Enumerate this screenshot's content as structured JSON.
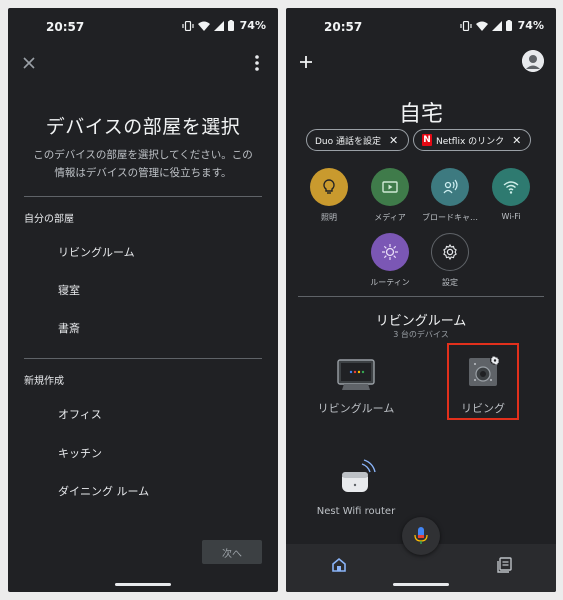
{
  "status_bar": {
    "time": "20:57",
    "battery": "74%"
  },
  "left_screen": {
    "title": "デバイスの部屋を選択",
    "description": "このデバイスの部屋を選択してください。この情報はデバイスの管理に役立ちます。",
    "section_my_rooms": "自分の部屋",
    "my_rooms": [
      "リビングルーム",
      "寝室",
      "書斎"
    ],
    "section_new": "新規作成",
    "new_rooms": [
      "オフィス",
      "キッチン",
      "ダイニング ルーム"
    ],
    "next_label": "次へ"
  },
  "right_screen": {
    "home_title": "自宅",
    "chips": [
      {
        "label": "Duo 通話を設定"
      },
      {
        "label": "Netflix のリンク",
        "logo": "N"
      }
    ],
    "actions": [
      {
        "label": "照明",
        "color": "#c99a2e",
        "icon": "lightbulb-icon"
      },
      {
        "label": "メディア",
        "color": "#3f7b4a",
        "icon": "media-icon"
      },
      {
        "label": "ブロードキャ…",
        "color": "#3d7a80",
        "icon": "broadcast-icon"
      },
      {
        "label": "Wi-Fi",
        "color": "#2e7a70",
        "icon": "wifi-icon"
      },
      {
        "label": "ルーティン",
        "color": "#7b57b5",
        "icon": "routine-icon"
      },
      {
        "label": "設定",
        "color": "#202124",
        "icon": "gear-icon"
      }
    ],
    "room_title": "リビングルーム",
    "room_count": "3 台のデバイス",
    "devices": [
      {
        "label": "リビングルーム",
        "icon": "nest-hub-icon"
      },
      {
        "label": "リビング",
        "icon": "camera-setup-icon"
      },
      {
        "label": "Nest Wifi router",
        "icon": "wifi-router-icon"
      }
    ],
    "highlight_color": "#e2301c"
  }
}
